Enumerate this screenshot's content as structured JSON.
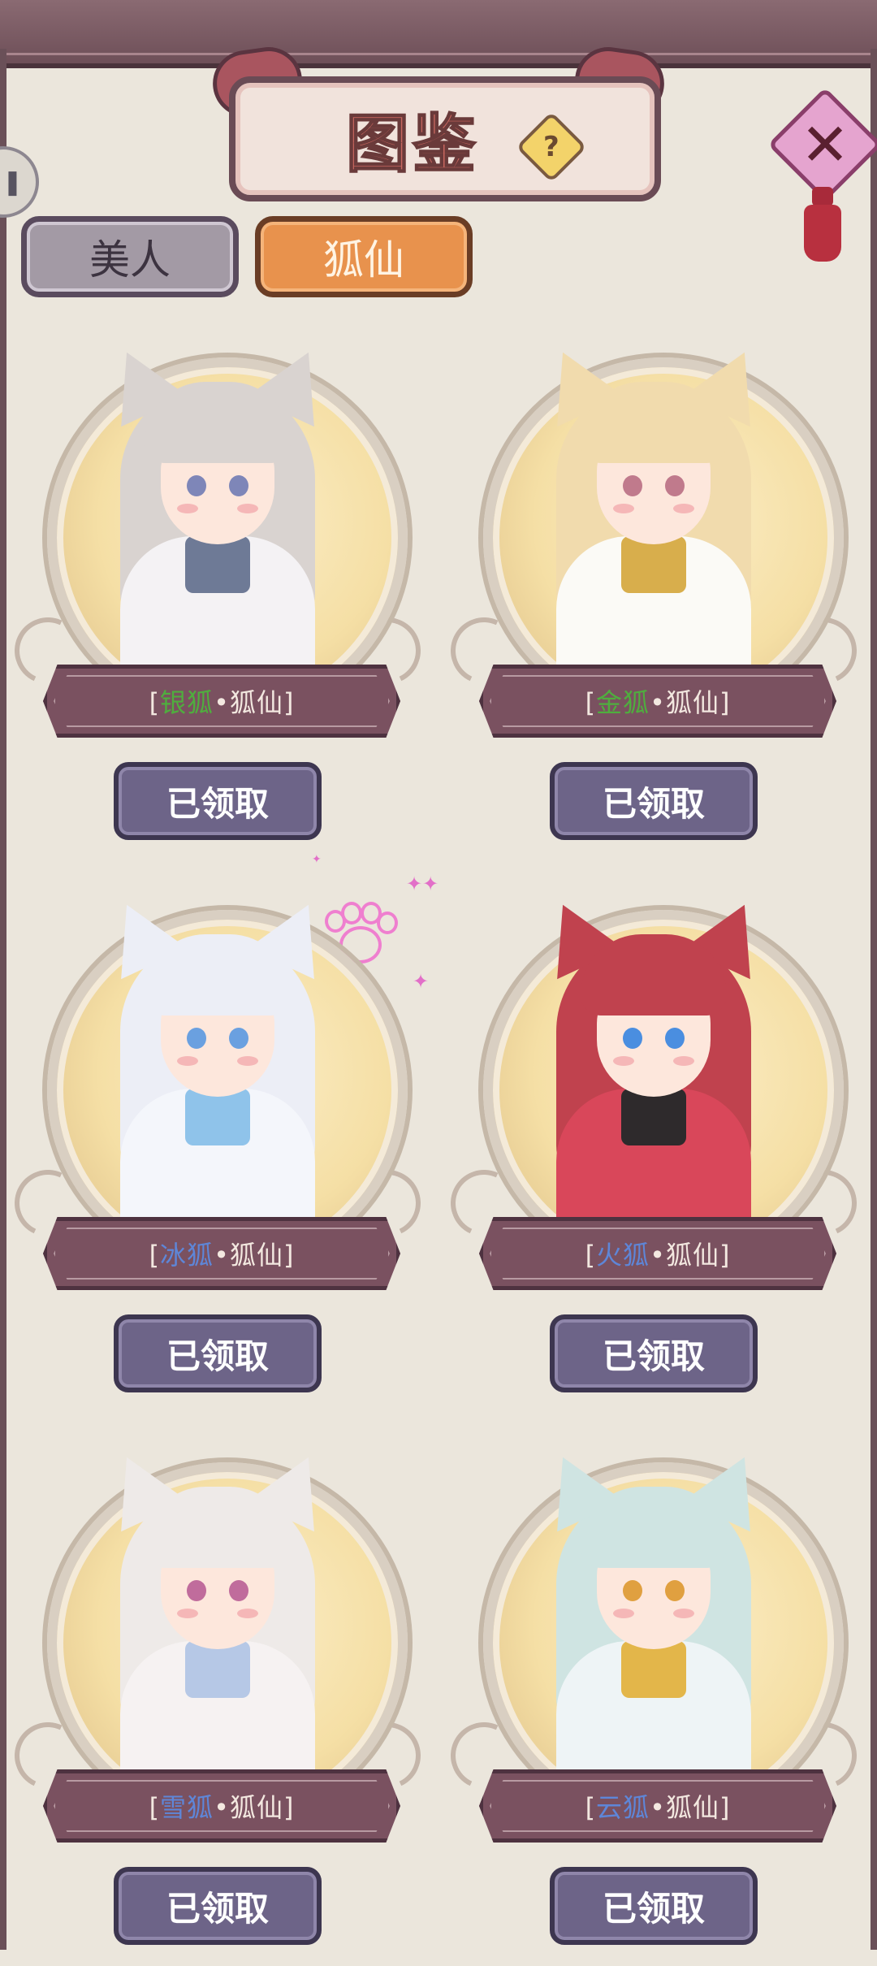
{
  "header": {
    "title": "图鉴",
    "help_label": "?",
    "close_label": "✕",
    "side_label": "❚❚"
  },
  "tabs": [
    {
      "label": "美人",
      "active": false
    },
    {
      "label": "狐仙",
      "active": true
    }
  ],
  "cards": [
    {
      "name": "银狐",
      "category": "狐仙",
      "name_color": "#4fae3e",
      "button": "已领取",
      "hair": "#d9d3d0",
      "outfit": "#f4f2f4",
      "accent": "#6e7a96",
      "eyes": "#7e86b8"
    },
    {
      "name": "金狐",
      "category": "狐仙",
      "name_color": "#4fae3e",
      "button": "已领取",
      "hair": "#f1dbad",
      "outfit": "#fbfaf6",
      "accent": "#d8ae4c",
      "eyes": "#c07a8c"
    },
    {
      "name": "冰狐",
      "category": "狐仙",
      "name_color": "#5e86d8",
      "button": "已领取",
      "hair": "#eceef6",
      "outfit": "#f4f6fb",
      "accent": "#8fc3ea",
      "eyes": "#6aa0e0"
    },
    {
      "name": "火狐",
      "category": "狐仙",
      "name_color": "#5e86d8",
      "button": "已领取",
      "hair": "#c0424e",
      "outfit": "#d9475a",
      "accent": "#2e2a2c",
      "eyes": "#4a8ee0"
    },
    {
      "name": "雪狐",
      "category": "狐仙",
      "name_color": "#5e86d8",
      "button": "已领取",
      "hair": "#eeeae8",
      "outfit": "#f6f2f2",
      "accent": "#b6c8e6",
      "eyes": "#c06c9c"
    },
    {
      "name": "云狐",
      "category": "狐仙",
      "name_color": "#5e86d8",
      "button": "已领取",
      "hair": "#cfe4e2",
      "outfit": "#eef4f6",
      "accent": "#e3b64a",
      "eyes": "#e0a040"
    }
  ]
}
